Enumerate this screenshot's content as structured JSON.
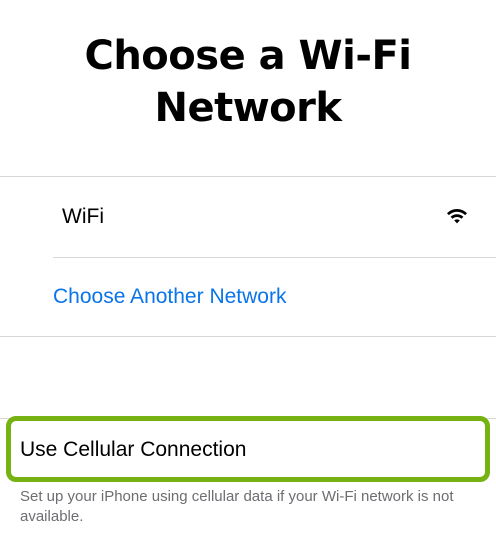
{
  "title": "Choose a Wi-Fi Network",
  "networks": [
    {
      "name": "WiFi",
      "icon": "wifi-icon"
    }
  ],
  "choose_another_label": "Choose Another Network",
  "cellular_label": "Use Cellular Connection",
  "footer_text": "Set up your iPhone using cellular data if your Wi-Fi network is not available.",
  "colors": {
    "link": "#0a74ea",
    "highlight": "#76b312",
    "footer": "#6d6d72",
    "separator": "#d8d8dc"
  }
}
